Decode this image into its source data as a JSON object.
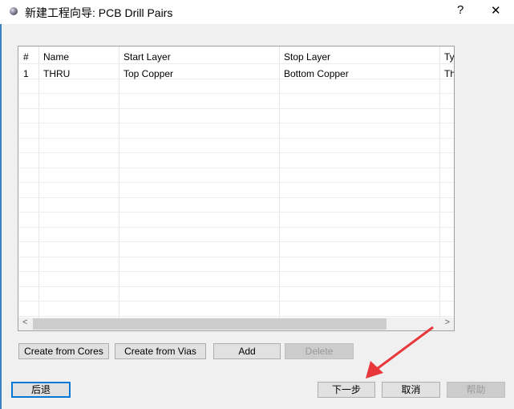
{
  "window": {
    "title": "新建工程向导: PCB Drill Pairs",
    "help": "?",
    "close": "✕"
  },
  "table": {
    "columns": [
      "#",
      "Name",
      "Start Layer",
      "Stop Layer",
      "Ty"
    ],
    "rows": [
      [
        "1",
        "THRU",
        "Top Copper",
        "Bottom Copper",
        "Th"
      ]
    ]
  },
  "buttons": {
    "create_from_cores": "Create from Cores",
    "create_from_vias": "Create from Vias",
    "add": "Add",
    "delete": "Delete"
  },
  "footer": {
    "back": "后退",
    "next": "下一步",
    "cancel": "取消",
    "help": "帮助"
  },
  "annotation": {
    "arrow_color": "#e8383b"
  }
}
